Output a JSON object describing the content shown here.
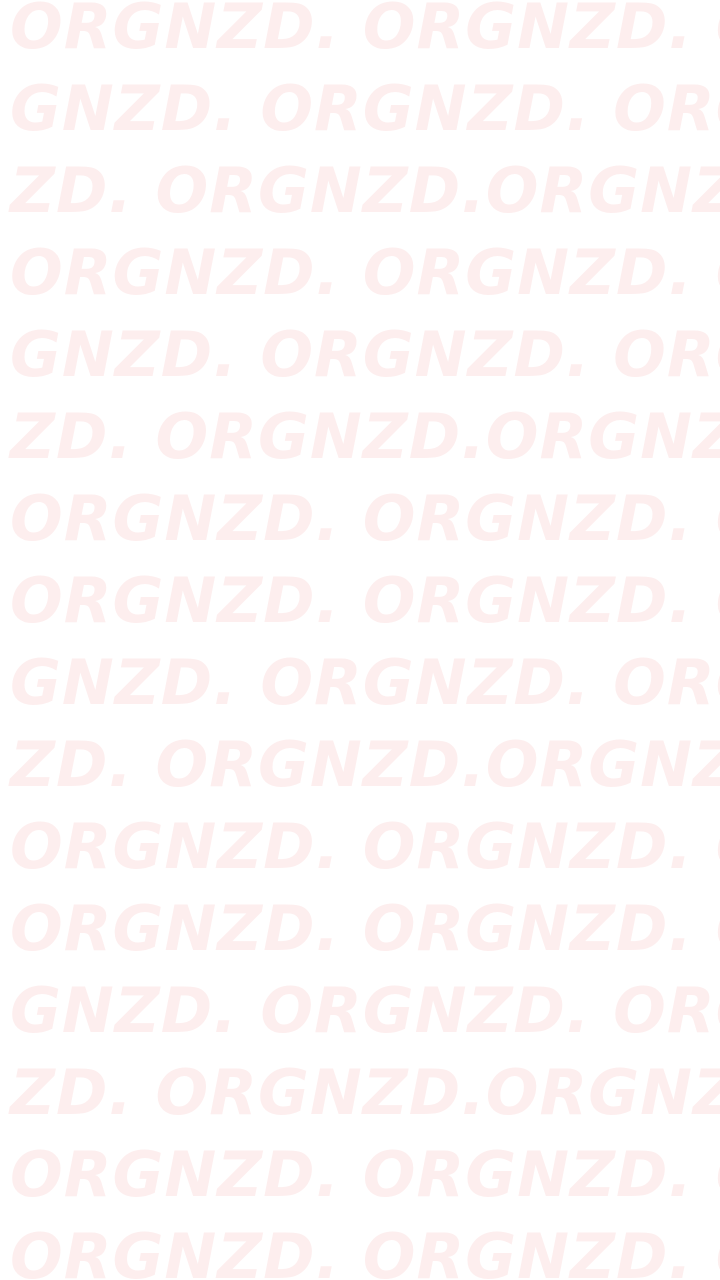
{
  "wallpaper": {
    "text_color": "#fdeeee",
    "background_color": "#ffffff",
    "rows": [
      "ORGNZD. ORGNZD. OR",
      "GNZD. ORGNZD. ORGN",
      "ZD. ORGNZD.ORGNZD.",
      "ORGNZD. ORGNZD. OR",
      "GNZD. ORGNZD. ORGN",
      "ZD. ORGNZD.ORGNZD.",
      "ORGNZD. ORGNZD. OR",
      "ORGNZD. ORGNZD. OR",
      "GNZD. ORGNZD. ORGN",
      "ZD. ORGNZD.ORGNZD.",
      "ORGNZD. ORGNZD. OR",
      "ORGNZD. ORGNZD. OR",
      "GNZD. ORGNZD. ORGN",
      "ZD. ORGNZD.ORGNZD.",
      "ORGNZD. ORGNZD. OR",
      "ORGNZD. ORGNZD. OR"
    ]
  }
}
